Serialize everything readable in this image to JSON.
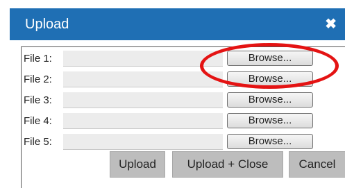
{
  "dialog": {
    "title": "Upload",
    "close_glyph": "✖"
  },
  "files": [
    {
      "label": "File 1:",
      "value": "",
      "browse_label": "Browse..."
    },
    {
      "label": "File 2:",
      "value": "",
      "browse_label": "Browse..."
    },
    {
      "label": "File 3:",
      "value": "",
      "browse_label": "Browse..."
    },
    {
      "label": "File 4:",
      "value": "",
      "browse_label": "Browse..."
    },
    {
      "label": "File 5:",
      "value": "",
      "browse_label": "Browse..."
    }
  ],
  "actions": {
    "upload_label": "Upload",
    "upload_close_label": "Upload + Close",
    "cancel_label": "Cancel"
  },
  "annotation": {
    "color": "#e41313"
  },
  "colors": {
    "titlebar": "#1f6fb4",
    "action_button": "#bdbdbd"
  }
}
